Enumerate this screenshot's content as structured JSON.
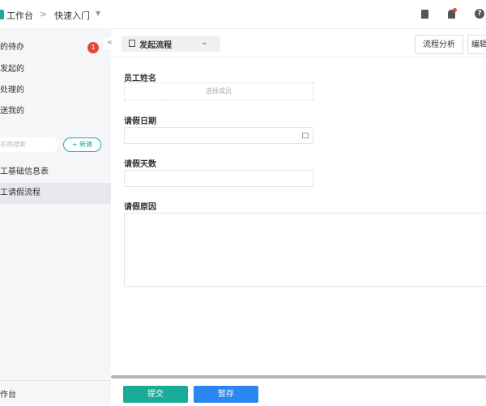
{
  "header": {
    "home": "工作台",
    "separator": ">",
    "current": "快速入门"
  },
  "sidebar": {
    "items": [
      {
        "label": "的待办",
        "badge": "1"
      },
      {
        "label": "发起的"
      },
      {
        "label": "处理的"
      },
      {
        "label": "送我的"
      }
    ],
    "search_placeholder": "名称搜索",
    "new_button": "+ 新建",
    "forms": [
      {
        "label": "工基础信息表"
      },
      {
        "label": "工请假流程",
        "selected": true
      }
    ],
    "bottom": "作台"
  },
  "toolbar": {
    "collapse": "«",
    "dropdown": "发起流程",
    "analyze": "流程分析",
    "edit": "编辑"
  },
  "form": {
    "employee_label": "员工姓名",
    "employee_placeholder": "选择成员",
    "date_label": "请假日期",
    "days_label": "请假天数",
    "reason_label": "请假原因"
  },
  "actions": {
    "submit": "提交",
    "save": "暂存"
  },
  "colors": {
    "submit": "#1aab98",
    "save": "#2a86f0",
    "badge": "#e8453c"
  }
}
